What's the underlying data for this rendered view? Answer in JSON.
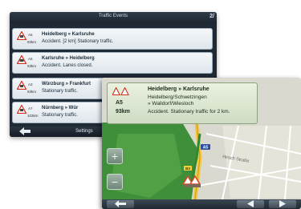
{
  "traffic_list": {
    "title": "Traffic Events",
    "page": "2/",
    "events": [
      {
        "road": "A5",
        "distance": "93km",
        "route": "Heidelberg » Karlsruhe",
        "description": "Accident. [2 km] Stationary traffic."
      },
      {
        "road": "A5",
        "distance": "93km",
        "route": "Karlsruhe » Heidelberg",
        "description": "Accident. Lanes closed."
      },
      {
        "road": "A3",
        "distance": "93km",
        "route": "Würzburg » Frankfurt",
        "description": "Stationary traffic."
      },
      {
        "road": "A7",
        "distance": "103km",
        "route": "Nürnberg » Wür",
        "description": "Stationary traffic."
      }
    ],
    "footer": {
      "back_icon": "arrow-left-icon",
      "settings_label": "Settings"
    }
  },
  "map_screen": {
    "popup": {
      "road": "A5",
      "distance": "93km",
      "route": "Heidelberg » Karlsruhe",
      "subroute_line1": "Heidelberg/Schwetzingen",
      "subroute_line2": "» Walldorf/Wiesloch",
      "description": "Accident. Stationary traffic for 2 km."
    },
    "zoom_in_label": "+",
    "zoom_out_label": "−",
    "road_shields": [
      "A5",
      "B3"
    ],
    "street_label": "Hirsch Straße",
    "colors": {
      "accent": "#2f8a2f",
      "warning": "#d94a1c"
    }
  }
}
